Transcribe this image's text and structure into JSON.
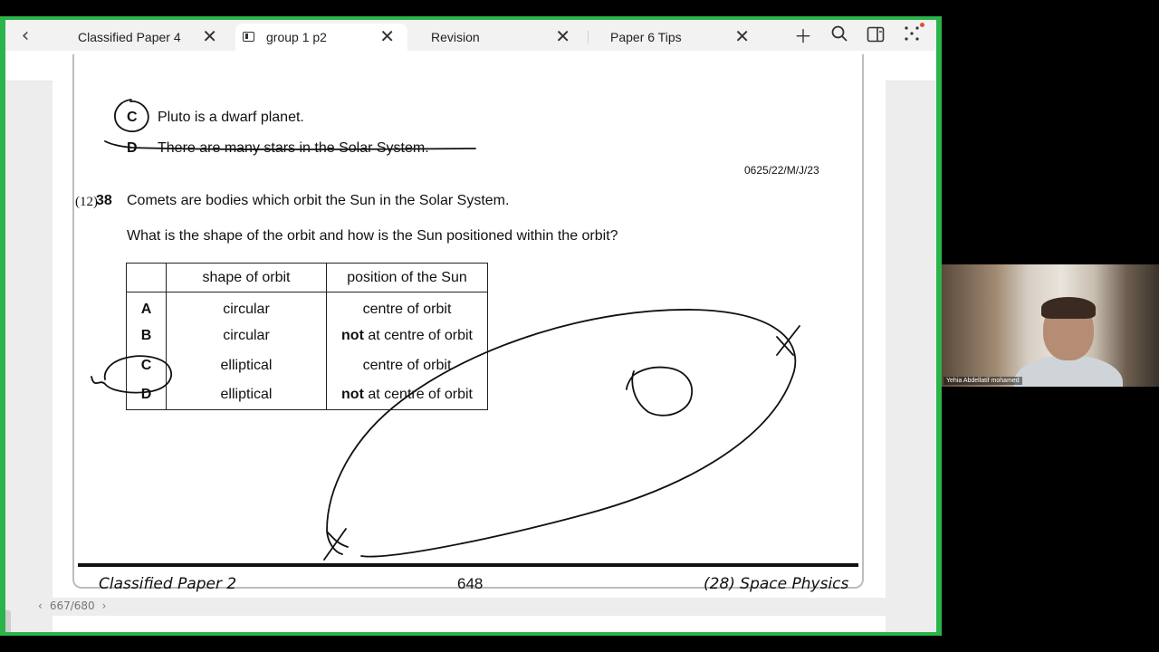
{
  "tabs": [
    {
      "label": "Classified Paper 4",
      "active": false
    },
    {
      "label": "group 1 p2",
      "active": true
    },
    {
      "label": "Revision",
      "active": false
    },
    {
      "label": "Paper 6 Tips",
      "active": false
    }
  ],
  "tab_close_glyph": "✕",
  "toolbar_icons": [
    "undo-icon",
    "redo-icon",
    "pen-icon",
    "fountain-pen-icon",
    "highlighter-icon",
    "eraser-icon",
    "lasso-icon",
    "text-box-icon",
    "shapes-icon",
    "image-icon",
    "sticker-icon",
    "zoom-icon",
    "laser-pointer-icon",
    "touch-mode-icon",
    "pattern-icon",
    "microphone-icon",
    "stroke-thin-icon",
    "stroke-medium-icon",
    "stroke-thick-icon"
  ],
  "colors": {
    "green_frame": "#2bb44a",
    "pen_black": "#111111",
    "pen_red": "#e8432e",
    "pen_green": "#5cb85c",
    "selected_tool_bg": "#dce6f7"
  },
  "document": {
    "prev_question": {
      "option_c_letter": "C",
      "option_c_text": "Pluto is a dwarf planet.",
      "option_d_letter": "D",
      "option_d_text": "There are many stars in the Solar System."
    },
    "paper_code": "0625/22/M/J/23",
    "handwritten_number": "(12)",
    "question_number": "38",
    "question_line_1": "Comets are bodies which orbit the Sun in the Solar System.",
    "question_line_2": "What is the shape of the orbit and how is the Sun positioned within the orbit?",
    "table": {
      "headers": [
        "",
        "shape of orbit",
        "position of the Sun"
      ],
      "rows": [
        {
          "letter": "A",
          "shape": "circular",
          "position_bold": "",
          "position": "centre of orbit"
        },
        {
          "letter": "B",
          "shape": "circular",
          "position_bold": "not",
          "position": " at centre of orbit"
        },
        {
          "letter": "C",
          "shape": "elliptical",
          "position_bold": "",
          "position": "centre of orbit"
        },
        {
          "letter": "D",
          "shape": "elliptical",
          "position_bold": "not",
          "position": " at centre of orbit"
        }
      ]
    },
    "footer": {
      "left": "Classified Paper 2",
      "center": "648",
      "right": "(28) Space Physics"
    }
  },
  "page_indicator": {
    "text": "667/680"
  },
  "video": {
    "participant_name": "Yehia Abdellatif mohamed"
  }
}
